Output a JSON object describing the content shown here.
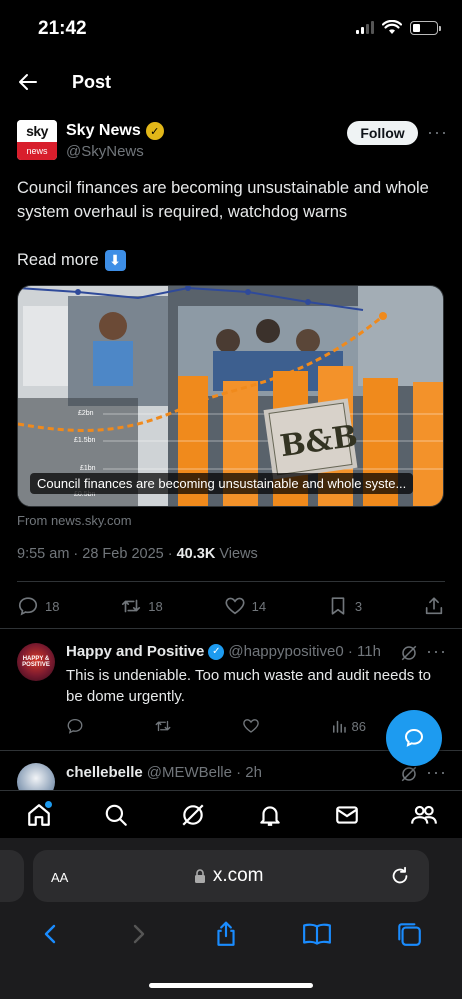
{
  "status": {
    "time": "21:42"
  },
  "header": {
    "title": "Post"
  },
  "post": {
    "author_name": "Sky News",
    "author_handle": "@SkyNews",
    "avatar_top": "sky",
    "avatar_bottom": "news",
    "follow_label": "Follow",
    "text": "Council finances are becoming unsustainable and whole system overhaul is required, watchdog warns",
    "read_more": "Read more",
    "card_caption": "Council finances are becoming unsustainable and whole syste...",
    "card_labels": [
      "£2bn",
      "£1.5bn",
      "£1bn",
      "£0.5bn"
    ],
    "card_sign": "B&B",
    "source": "From news.sky.com",
    "time": "9:55 am · 28 Feb 2025 · ",
    "views_count": "40.3K",
    "views_label": " Views",
    "replies": "18",
    "reposts": "18",
    "likes": "14",
    "bookmarks": "3"
  },
  "replies": [
    {
      "name": "Happy and Positive",
      "handle": "@happypositive0 · 11h",
      "avatar_text": "HAPPY & POSITIVE",
      "text": "This is undeniable. Too much waste and audit needs to be dome urgently.",
      "views": "86"
    },
    {
      "name": "chellebelle",
      "handle": "@MEWBelle · 2h"
    }
  ],
  "browser": {
    "aa": "AA",
    "url": "x.com"
  },
  "colors": {
    "accent": "#1d9bf0",
    "follow_bg": "#eff3f4",
    "gold_badge": "#e2b719",
    "sky_red": "#d81e2c"
  }
}
